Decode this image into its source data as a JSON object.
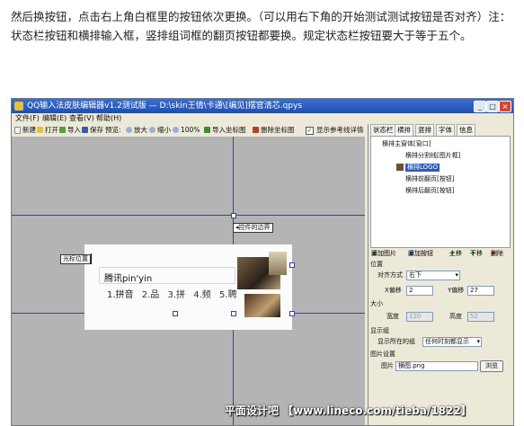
{
  "article": {
    "paragraph": "然后换按钮，点击右上角白框里的按钮依次更换。（可以用右下角的开始测试测试按钮是否对齐）注：状态栏按钮和横排输入框，竖排组词框的翻页按钮都要换。规定状态栏按钮要大于等于五个。"
  },
  "window": {
    "title": "QQ输入法皮肤编辑器v1.2测试版  — D:\\skin王倩\\卡通\\[编见]摆官清芯.qpys",
    "controls": [
      "_",
      "□",
      "×"
    ]
  },
  "menu": [
    "文件(F)",
    "编辑(E)",
    "查看(V)",
    "帮助(H)"
  ],
  "toolbar": {
    "new": "新建",
    "open": "打开",
    "import": "导入",
    "save": "保存",
    "preview": "预览:",
    "zoom_in": "放大",
    "zoom_out": "缩小",
    "zoom_100": "100%",
    "import_image": "导入坐标图",
    "delete_image": "删除坐标图",
    "show_ref_line": "显示参考线详情",
    "show_ref_checked": true
  },
  "canvas": {
    "callout_boundary": "控件的边界",
    "callout_cursor": "光标位置",
    "composition": "腾讯pin'yin",
    "candidates": [
      "1.拼音",
      "2.品",
      "3.拼",
      "4.频",
      "5.聘"
    ],
    "cursor_glyph": "I"
  },
  "right_panel": {
    "tabs": [
      "状态栏",
      "横排",
      "竖排",
      "字体",
      "信息"
    ],
    "active_tab": "横排",
    "tree": [
      "横排主窗体[窗口]",
      "横排分割线[图片框]",
      "横排LOGO",
      "横排前翻页[按钮]",
      "横排后翻页[按钮]"
    ],
    "tree_selected": "横排LOGO",
    "actions": [
      "添加图片",
      "添加按钮",
      "上移",
      "下移",
      "删除"
    ],
    "props": {
      "position_title": "位置",
      "align_label": "对齐方式",
      "align_value": "右下",
      "x_label": "X偏移",
      "x_value": "2",
      "y_label": "Y偏移",
      "y_value": "27",
      "size_title": "大小",
      "width_label": "宽度",
      "width_value": "120",
      "height_label": "高度",
      "height_value": "52",
      "display_title": "显示组",
      "display_label": "显示所在的组",
      "display_value": "任何时刻都显示",
      "image_title": "图片设置",
      "image_label": "图片",
      "image_value": "横图.png",
      "browse": "浏览"
    }
  },
  "watermark": "平面设计吧 【www.lineco.com/tieba/1822】"
}
